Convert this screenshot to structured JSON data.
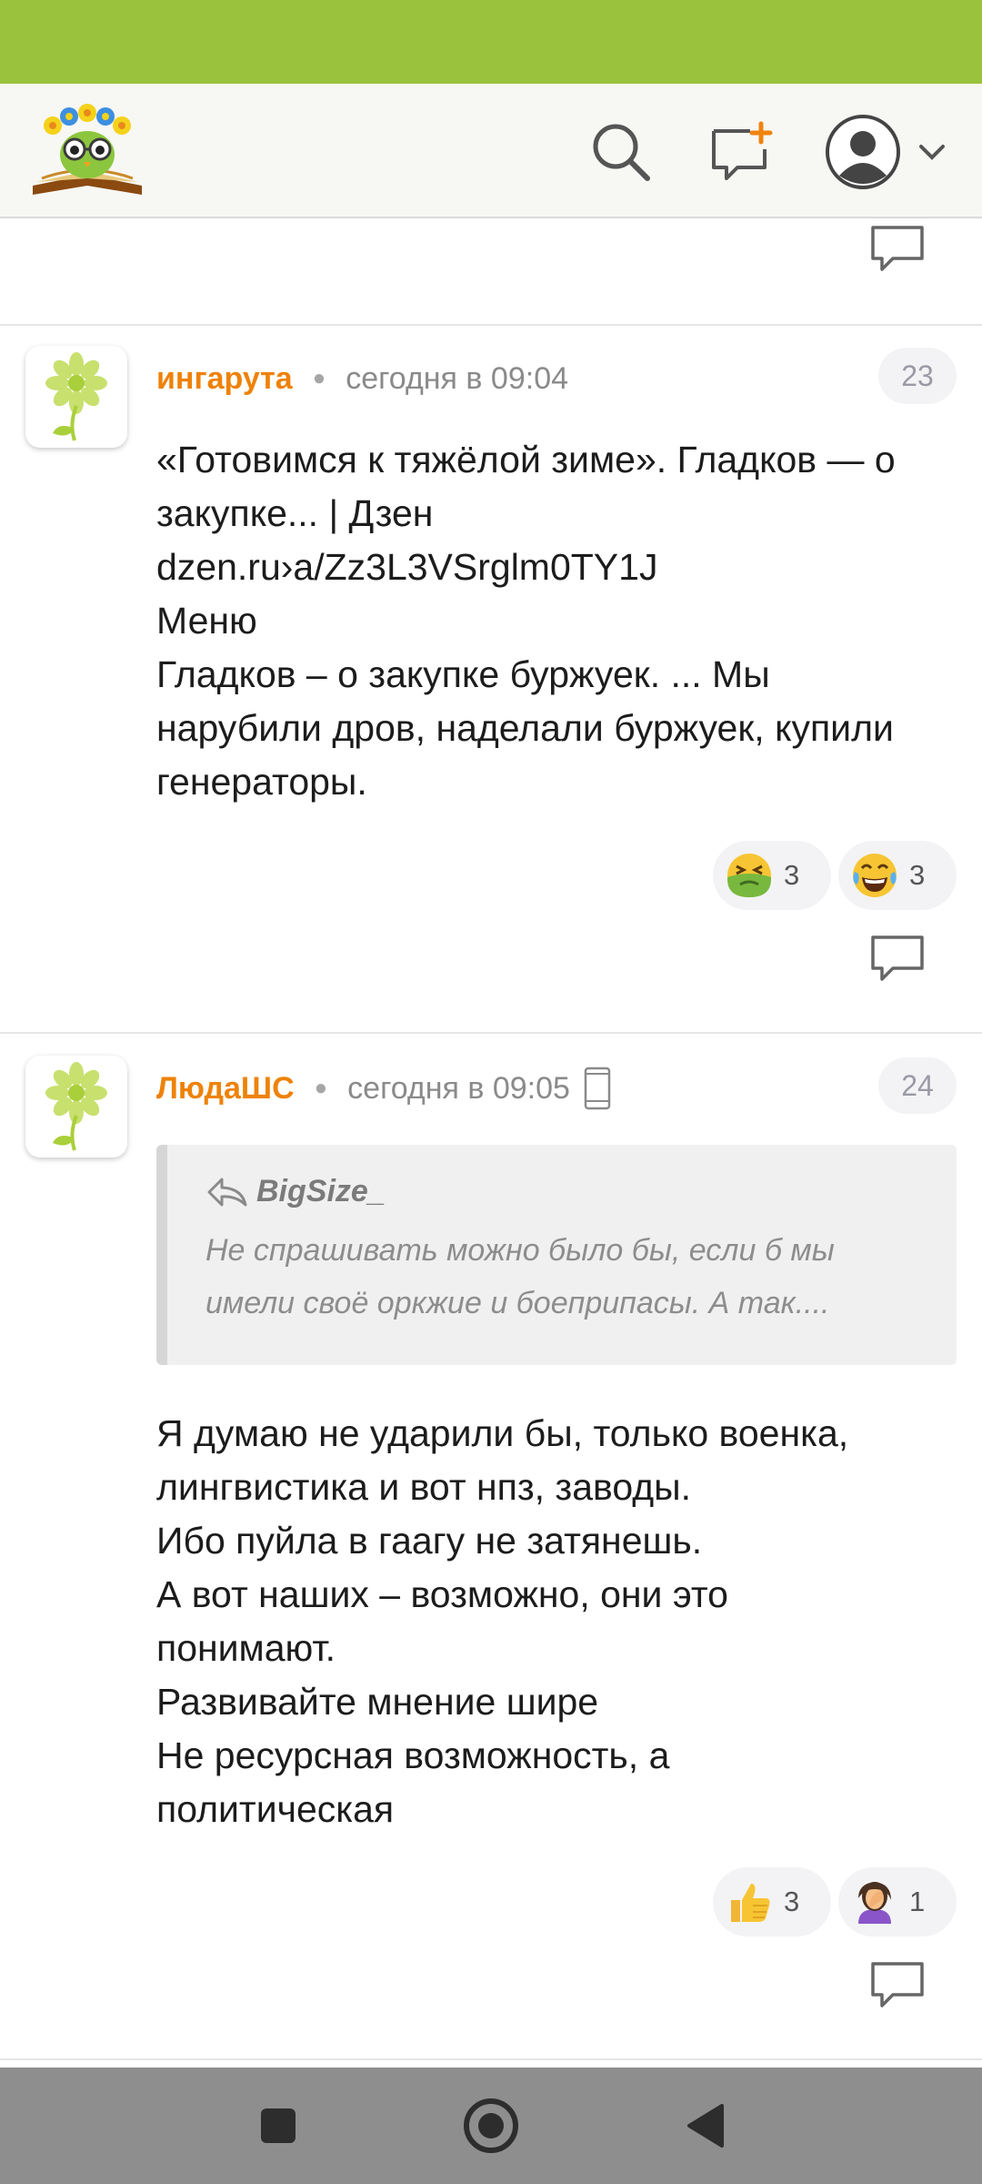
{
  "header": {
    "logo_icon": "owl-with-flowers-on-book-logo",
    "search_icon": "search-icon",
    "new_post_icon": "new-comment-plus-icon",
    "profile_icon": "profile-avatar-icon",
    "menu_icon": "chevron-down-icon"
  },
  "colors": {
    "status_bar": "#9bc23c",
    "author_orange": "#ee8208",
    "badge_background": "#f3f3f5"
  },
  "comments": [
    {
      "author": "ингарута",
      "time": "сегодня в 09:04",
      "number": "23",
      "text_lines": [
        "«Готовимся к тяжёлой зиме». Гладков — о",
        "закупке... | Дзен",
        "dzen.ru›a/Zz3L3VSrglm0TY1J",
        "Меню",
        "Гладков – о закупке буржуек. ... Мы",
        "нарубили дров, наделали буржуек, купили",
        "генераторы."
      ],
      "reactions": [
        {
          "icon": "nauseated-face-emoji",
          "count": "3"
        },
        {
          "icon": "tears-of-joy-emoji",
          "count": "3"
        }
      ]
    },
    {
      "author": "ЛюдаШС",
      "time": "сегодня в 09:05",
      "device_icon": "mobile-phone-icon",
      "number": "24",
      "quote": {
        "author": "BigSize_",
        "lines": [
          "Не спрашивать можно было бы, если б мы",
          "имели своё оркжие и боеприпасы. А так...."
        ]
      },
      "text_lines": [
        "Я думаю не ударили бы, только военка,",
        "лингвистика и вот нпз, заводы.",
        "Ибо пуйла в гаагу не затянешь.",
        "А вот наших – возможно, они это",
        "понимают.",
        "Развивайте мнение шире",
        "Не ресурсная возможность, а",
        "политическая"
      ],
      "reactions": [
        {
          "icon": "thumbs-up-emoji",
          "count": "3"
        },
        {
          "icon": "woman-facepalming-emoji",
          "count": "1"
        }
      ]
    }
  ],
  "navbar": {
    "recents_icon": "square-recents-icon",
    "home_icon": "circle-home-icon",
    "back_icon": "triangle-back-icon"
  }
}
